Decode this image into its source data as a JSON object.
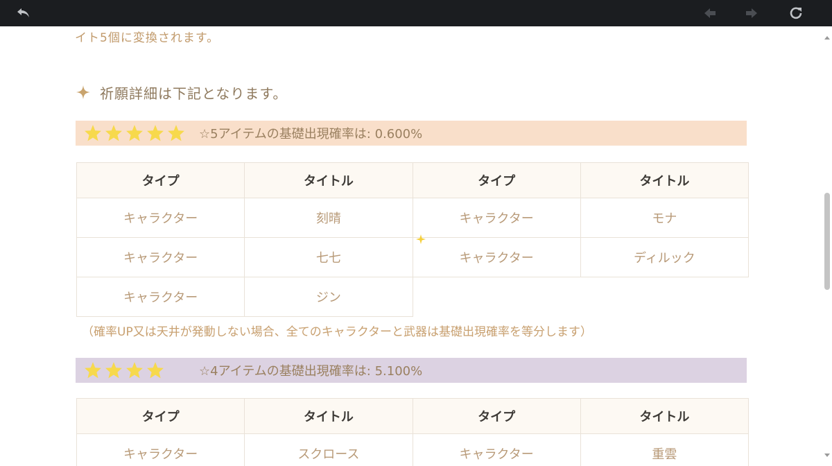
{
  "toolbar": {
    "back_icon": "back-arrow-icon",
    "prev_icon": "prev-arrow-icon",
    "next_icon": "next-arrow-icon",
    "refresh_icon": "refresh-icon"
  },
  "intro_cut": "イト5個に変換されます。",
  "section_title": "祈願詳細は下記となります。",
  "five_star": {
    "stars": 5,
    "rate_text": "☆5アイテムの基礎出現確率は: 0.600%",
    "headers": [
      "タイプ",
      "タイトル",
      "タイプ",
      "タイトル"
    ],
    "rows": [
      [
        "キャラクター",
        "刻晴",
        "キャラクター",
        "モナ"
      ],
      [
        "キャラクター",
        "七七",
        "キャラクター",
        "ディルック"
      ],
      [
        "キャラクター",
        "ジン",
        "",
        ""
      ]
    ]
  },
  "note": "（確率UP又は天井が発動しない場合、全てのキャラクターと武器は基礎出現確率を等分します）",
  "four_star": {
    "stars": 4,
    "rate_text": "☆4アイテムの基礎出現確率は: 5.100%",
    "headers": [
      "タイプ",
      "タイトル",
      "タイプ",
      "タイトル"
    ],
    "rows": [
      [
        "キャラクター",
        "スクロース",
        "キャラクター",
        "重雲"
      ]
    ]
  },
  "colors": {
    "topbar": "#1b1d20",
    "five_bar": "#f9dfca",
    "four_bar": "#dcd2e2",
    "star": "#f7d94c",
    "accent_text": "#c8a070"
  }
}
